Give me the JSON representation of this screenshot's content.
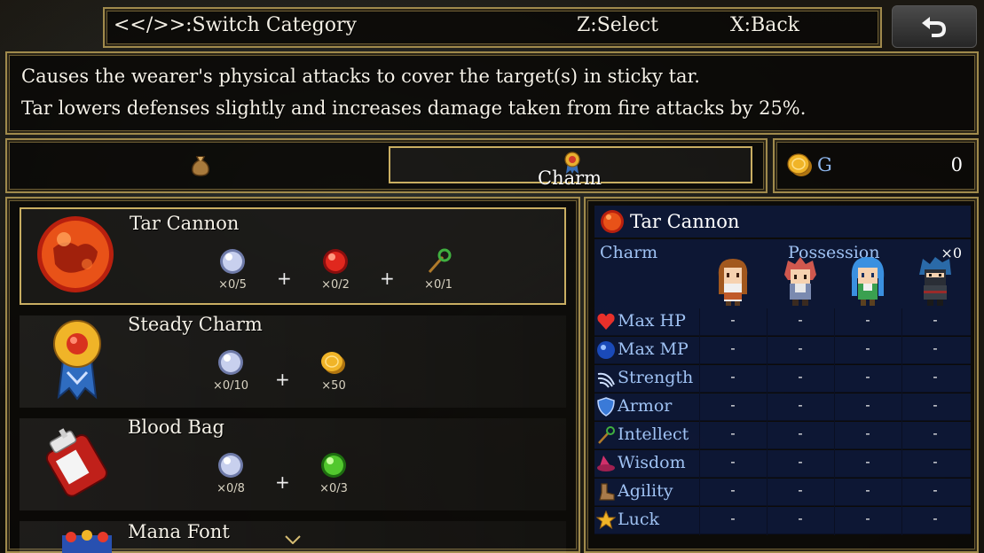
{
  "hints": {
    "switch_category": "<</>>:Switch Category",
    "select": "Z:Select",
    "back": "X:Back"
  },
  "back_button_icon": "return-arrow-icon",
  "description": {
    "line1": "Causes the wearer's physical attacks to cover the target(s) in sticky tar.",
    "line2": "Tar lowers defenses slightly and increases damage taken from fire attacks by 25%."
  },
  "tabs": [
    {
      "icon": "bag-icon",
      "label": ""
    },
    {
      "icon": "medal-icon",
      "label": "Charm",
      "selected": true
    }
  ],
  "gold": {
    "icon": "coin-icon",
    "label": "G",
    "amount": "0"
  },
  "items": [
    {
      "name": "Tar Cannon",
      "icon": "tar-orb-icon",
      "selected": true,
      "materials": [
        {
          "icon": "silver-orb-icon",
          "count": "×0/5"
        },
        {
          "icon": "red-orb-icon",
          "count": "×0/2"
        },
        {
          "icon": "staff-icon",
          "count": "×0/1"
        }
      ]
    },
    {
      "name": "Steady Charm",
      "icon": "medal-ribbon-icon",
      "materials": [
        {
          "icon": "silver-orb-icon",
          "count": "×0/10"
        },
        {
          "icon": "gold-coin-icon",
          "count": "×50"
        }
      ]
    },
    {
      "name": "Blood Bag",
      "icon": "blood-bag-icon",
      "materials": [
        {
          "icon": "silver-orb-icon",
          "count": "×0/8"
        },
        {
          "icon": "green-orb-icon",
          "count": "×0/3"
        }
      ]
    },
    {
      "name": "Mana Font",
      "icon": "mana-font-icon",
      "materials": []
    }
  ],
  "plus_sign": "+",
  "detail": {
    "item_name": "Tar Cannon",
    "category": "Charm",
    "possession_label": "Possession",
    "possession_count": "×0",
    "characters": [
      "brown-haired-girl",
      "red-haired-boy",
      "blue-haired-girl",
      "masked-ninja"
    ],
    "stats": [
      {
        "label": "Max HP",
        "icon": "heart-icon",
        "values": [
          "-",
          "-",
          "-",
          "-"
        ]
      },
      {
        "label": "Max MP",
        "icon": "blue-orb-icon",
        "values": [
          "-",
          "-",
          "-",
          "-"
        ]
      },
      {
        "label": "Strength",
        "icon": "claw-icon",
        "values": [
          "-",
          "-",
          "-",
          "-"
        ]
      },
      {
        "label": "Armor",
        "icon": "shield-icon",
        "values": [
          "-",
          "-",
          "-",
          "-"
        ]
      },
      {
        "label": "Intellect",
        "icon": "staff-icon",
        "values": [
          "-",
          "-",
          "-",
          "-"
        ]
      },
      {
        "label": "Wisdom",
        "icon": "wizard-hat-icon",
        "values": [
          "-",
          "-",
          "-",
          "-"
        ]
      },
      {
        "label": "Agility",
        "icon": "boot-icon",
        "values": [
          "-",
          "-",
          "-",
          "-"
        ]
      },
      {
        "label": "Luck",
        "icon": "star-icon",
        "values": [
          "-",
          "-",
          "-",
          "-"
        ]
      }
    ]
  },
  "colors": {
    "frame_gold": "#c9ae62",
    "stat_label_blue": "#9fc2f3",
    "table_bg": "#0e1a3c"
  }
}
